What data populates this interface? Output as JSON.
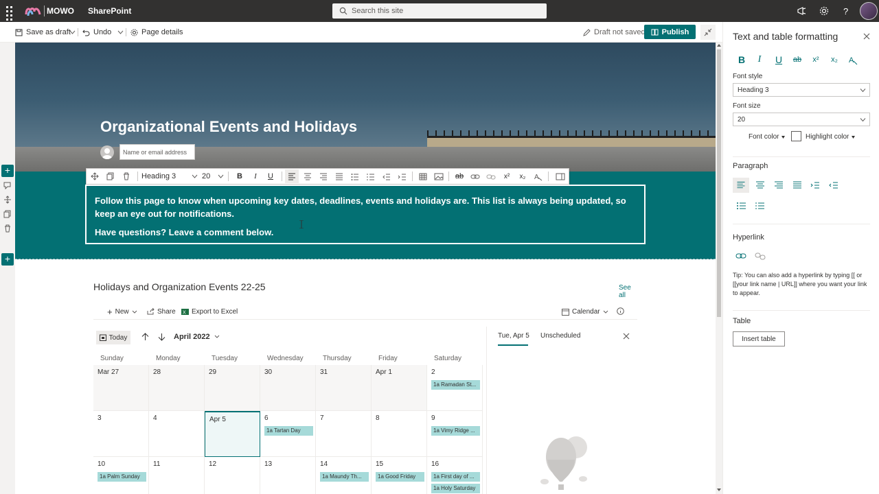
{
  "suite": {
    "brand": "MOWO",
    "app_name": "SharePoint",
    "search_placeholder": "Search this site"
  },
  "command_bar": {
    "save_draft": "Save as draft",
    "undo": "Undo",
    "page_details": "Page details",
    "draft_status": "Draft not saved",
    "publish": "Publish"
  },
  "hero": {
    "title": "Organizational Events and Holidays",
    "author_placeholder": "Name or email address"
  },
  "text_toolbar": {
    "style": "Heading 3",
    "size": "20"
  },
  "text_section": {
    "paragraph1": "Follow this page to know when upcoming key dates, deadlines, events and holidays are.  This list is always being updated, so keep an eye out for notifications.",
    "paragraph2": "Have questions?  Leave a comment below."
  },
  "events": {
    "title": "Holidays and Organization Events 22-25",
    "see_all": "See all",
    "commands": {
      "new": "New",
      "share": "Share",
      "export": "Export to Excel",
      "view": "Calendar"
    },
    "today": "Today",
    "month": "April 2022",
    "weekdays": [
      "Sunday",
      "Monday",
      "Tuesday",
      "Wednesday",
      "Thursday",
      "Friday",
      "Saturday"
    ],
    "weeks": [
      [
        {
          "d": "Mar 27"
        },
        {
          "d": "28"
        },
        {
          "d": "29"
        },
        {
          "d": "30"
        },
        {
          "d": "31"
        },
        {
          "d": "Apr 1"
        },
        {
          "d": "2",
          "events": [
            "1a Ramadan St..."
          ]
        }
      ],
      [
        {
          "d": "3"
        },
        {
          "d": "4"
        },
        {
          "d": "Apr 5"
        },
        {
          "d": "6",
          "events": [
            "1a Tartan Day"
          ]
        },
        {
          "d": "7"
        },
        {
          "d": "8"
        },
        {
          "d": "9",
          "events": [
            "1a Vimy Ridge ..."
          ]
        }
      ],
      [
        {
          "d": "10",
          "events": [
            "1a Palm Sunday"
          ]
        },
        {
          "d": "11"
        },
        {
          "d": "12"
        },
        {
          "d": "13"
        },
        {
          "d": "14",
          "events": [
            "1a Maundy Th..."
          ]
        },
        {
          "d": "15",
          "events": [
            "1a Good Friday"
          ]
        },
        {
          "d": "16",
          "events": [
            "1a First day of ...",
            "1a Holy Saturday"
          ]
        }
      ]
    ],
    "side_tab_selected": "Tue, Apr 5",
    "side_tab_other": "Unscheduled"
  },
  "pane": {
    "title": "Text and table formatting",
    "font_style_label": "Font style",
    "font_style_value": "Heading 3",
    "font_size_label": "Font size",
    "font_size_value": "20",
    "font_color": "Font color",
    "highlight_color": "Highlight color",
    "paragraph_label": "Paragraph",
    "hyperlink_label": "Hyperlink",
    "tip": "Tip: You can also add a hyperlink by typing [[ or [[your link name | URL]] where you want your link to appear.",
    "table_label": "Table",
    "insert_table": "Insert table"
  },
  "colors": {
    "accent": "#037073",
    "event_fill": "#a6dad9",
    "suite_bar": "#323130"
  }
}
